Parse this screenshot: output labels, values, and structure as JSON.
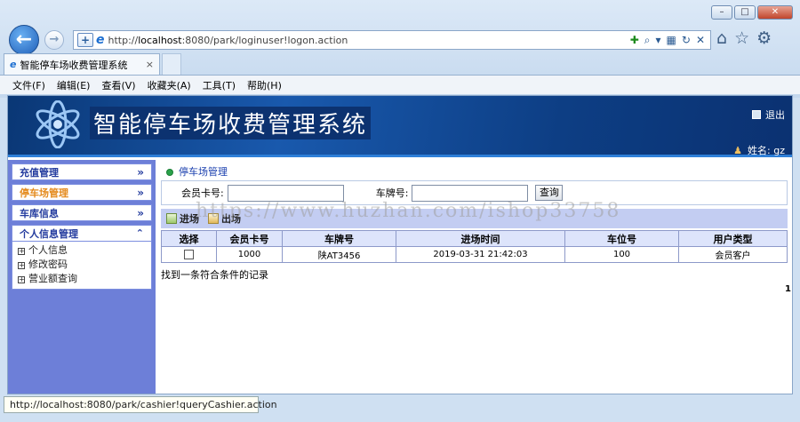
{
  "browser": {
    "url_prefix": "http://",
    "url_host": "localhost",
    "url_rest": ":8080/park/loginuser!logon.action",
    "tab_title": "智能停车场收费管理系统",
    "tab_close": "×",
    "menus": [
      "文件(F)",
      "编辑(E)",
      "查看(V)",
      "收藏夹(A)",
      "工具(T)",
      "帮助(H)"
    ],
    "window_buttons": [
      "–",
      "□",
      "✕"
    ],
    "status_url": "http://localhost:8080/park/cashier!queryCashier.action"
  },
  "header": {
    "title": "智能停车场收费管理系统",
    "logout": "退出",
    "user": "姓名: gz"
  },
  "sidebar": {
    "items": [
      {
        "label": "充值管理",
        "arrow": "»"
      },
      {
        "label": "停车场管理",
        "arrow": "»"
      },
      {
        "label": "车库信息",
        "arrow": "»"
      },
      {
        "label": "个人信息管理",
        "arrow": "⌃"
      }
    ],
    "subitems": [
      "个人信息",
      "修改密码",
      "营业额查询"
    ]
  },
  "main": {
    "breadcrumb": "停车场管理",
    "search": {
      "card_label": "会员卡号:",
      "plate_label": "车牌号:",
      "card_value": "",
      "plate_value": "",
      "button": "查询"
    },
    "toolbar": {
      "enter": "进场",
      "exit": "出场"
    },
    "table": {
      "headers": [
        "选择",
        "会员卡号",
        "车牌号",
        "进场时间",
        "车位号",
        "用户类型"
      ],
      "rows": [
        {
          "card": "1000",
          "plate": "陕AT3456",
          "time": "2019-03-31 21:42:03",
          "slot": "100",
          "type": "会员客户"
        }
      ]
    },
    "found_text": "找到一条符合条件的记录",
    "page": "1"
  },
  "watermark": "https://www.huzhan.com/ishop33758"
}
